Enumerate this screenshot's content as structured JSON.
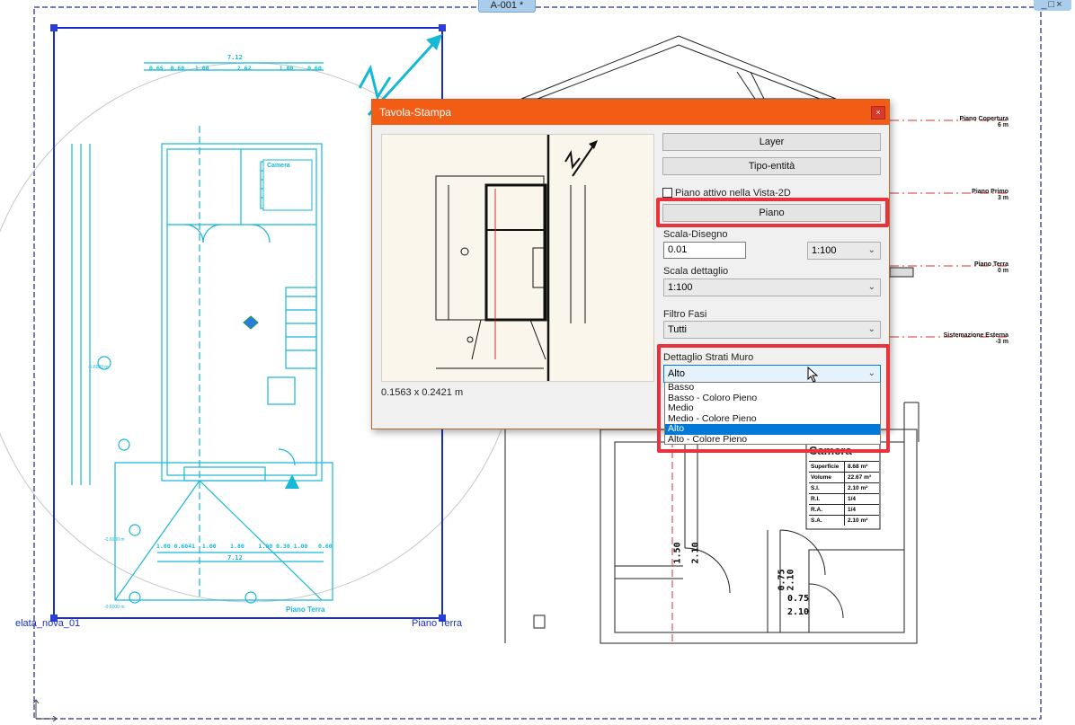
{
  "sheet_tab": "A-001 *",
  "window_controls": "_□×",
  "plan_labels": {
    "left_bottom": "elata_nova_01",
    "right_bottom": "Piano Terra",
    "inner_plan": "Piano Terra"
  },
  "drawing": {
    "dim_top": "7.12",
    "dim_sub": "0.65  0.60   1.00        2.62        1.00    0.60",
    "dim_bottom": "7.12",
    "dim_bottom_sub": "1.00 0.6041  1.00    1.80    1.00 0.30 1.00   0.60",
    "levels": [
      {
        "name": "Piano Copertura",
        "value": "6 m"
      },
      {
        "name": "Piano Primo",
        "value": "3 m"
      },
      {
        "name": "Piano Terra",
        "value": "0 m"
      },
      {
        "name": "Sistemazione Esterna",
        "value": "-3 m"
      }
    ],
    "room_table": {
      "title": "Camera",
      "rows": [
        [
          "Superficie",
          "8.68 m²"
        ],
        [
          "Volume",
          "22.67 m³"
        ],
        [
          "S.I.",
          "2.10 m²"
        ],
        [
          "R.I.",
          "1/4"
        ],
        [
          "R.A.",
          "1/4"
        ],
        [
          "S.A.",
          "2.10 m²"
        ]
      ]
    },
    "door_dims": [
      "1.50",
      "2.10",
      "0.75",
      "2.10",
      "0.75",
      "2.10"
    ],
    "elev_left": "-0.6000 m",
    "elev_left2": "-0.6000 m",
    "elev_left3": "-0.6000 m"
  },
  "dialog": {
    "title": "Tavola-Stampa",
    "close": "×",
    "preview_dims": "0.1563 x 0.2421 m",
    "buttons": {
      "layer": "Layer",
      "entity_type": "Tipo-entità",
      "floor": "Piano"
    },
    "checkbox_label": "Piano attivo nella Vista-2D",
    "drawing_scale": {
      "label": "Scala-Disegno",
      "value": "0.01",
      "ratio": "1:100"
    },
    "detail_scale": {
      "label": "Scala dettaglio",
      "value": "1:100"
    },
    "phase_filter": {
      "label": "Filtro Fasi",
      "value": "Tutti"
    },
    "wall_layers": {
      "label": "Dettaglio Strati Muro",
      "value": "Alto",
      "options": [
        "Basso",
        "Basso - Coloro Pieno",
        "Medio",
        "Medio - Colore Pieno",
        "Alto",
        "Alto - Colore Pieno"
      ],
      "selected_index": 4
    }
  }
}
